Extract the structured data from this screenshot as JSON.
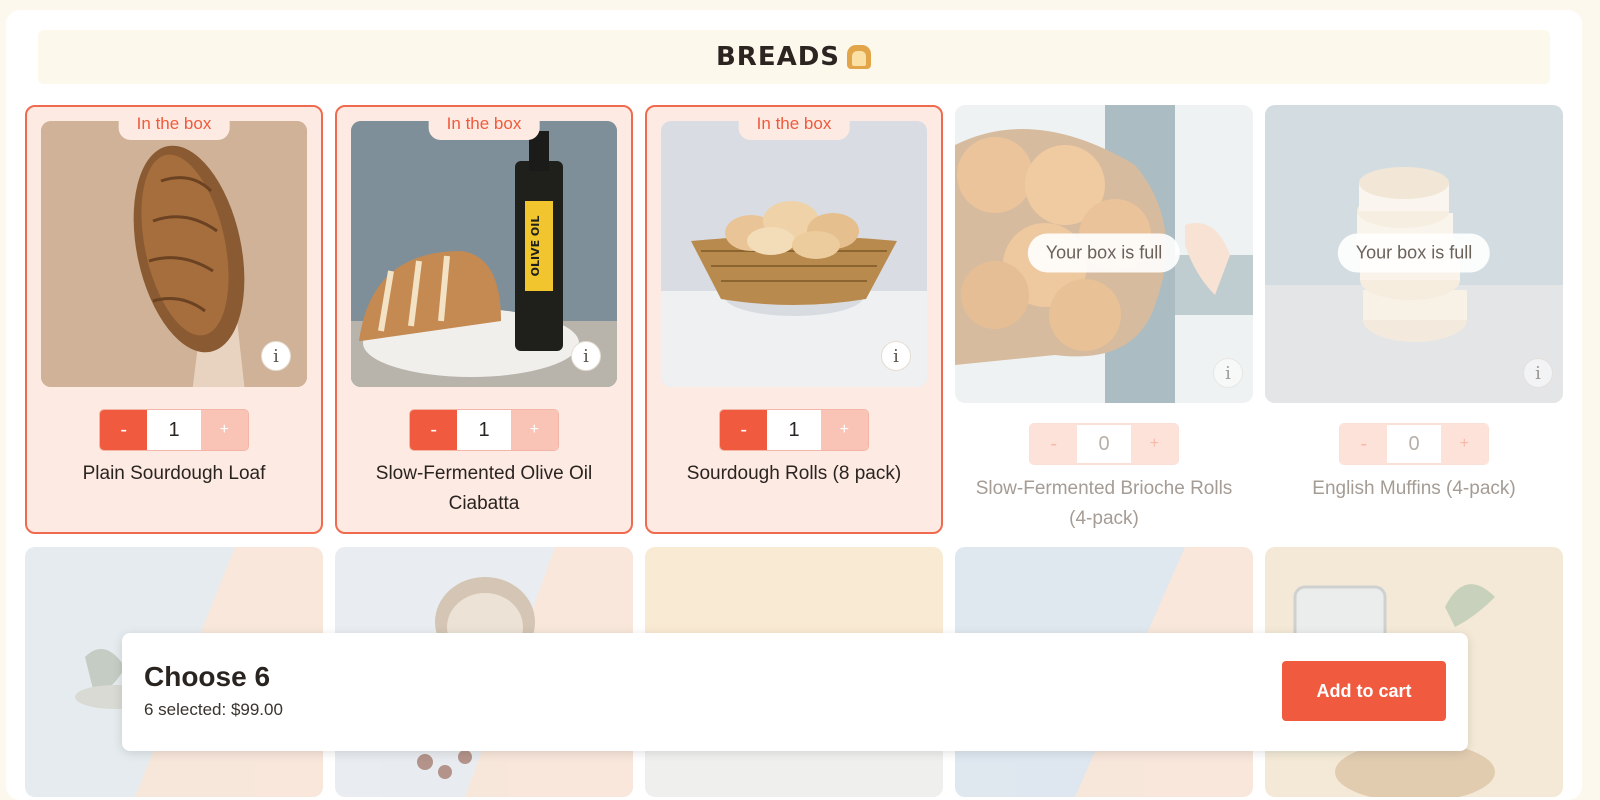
{
  "section": {
    "title": "BREADS",
    "emoji": "bread-emoji"
  },
  "products": [
    {
      "name": "Plain Sourdough Loaf",
      "qty": "1",
      "status": "In the box",
      "minus": "-",
      "plus": "+"
    },
    {
      "name": "Slow-Fermented Olive Oil Ciabatta",
      "qty": "1",
      "status": "In the box",
      "minus": "-",
      "plus": "+"
    },
    {
      "name": "Sourdough Rolls (8 pack)",
      "qty": "1",
      "status": "In the box",
      "minus": "-",
      "plus": "+"
    },
    {
      "name": "Slow-Fermented Brioche Rolls (4-pack)",
      "qty": "0",
      "status": "Your box is full",
      "minus": "-",
      "plus": "+"
    },
    {
      "name": "English Muffins (4-pack)",
      "qty": "0",
      "status": "Your box is full",
      "minus": "-",
      "plus": "+"
    }
  ],
  "info_icon": "i",
  "sticky": {
    "title": "Choose 6",
    "summary": "6 selected: $99.00",
    "button": "Add to cart"
  },
  "colors": {
    "accent": "#f05a3f",
    "selected_bg": "#fdebe3",
    "header_bg": "#fcf8ec"
  }
}
